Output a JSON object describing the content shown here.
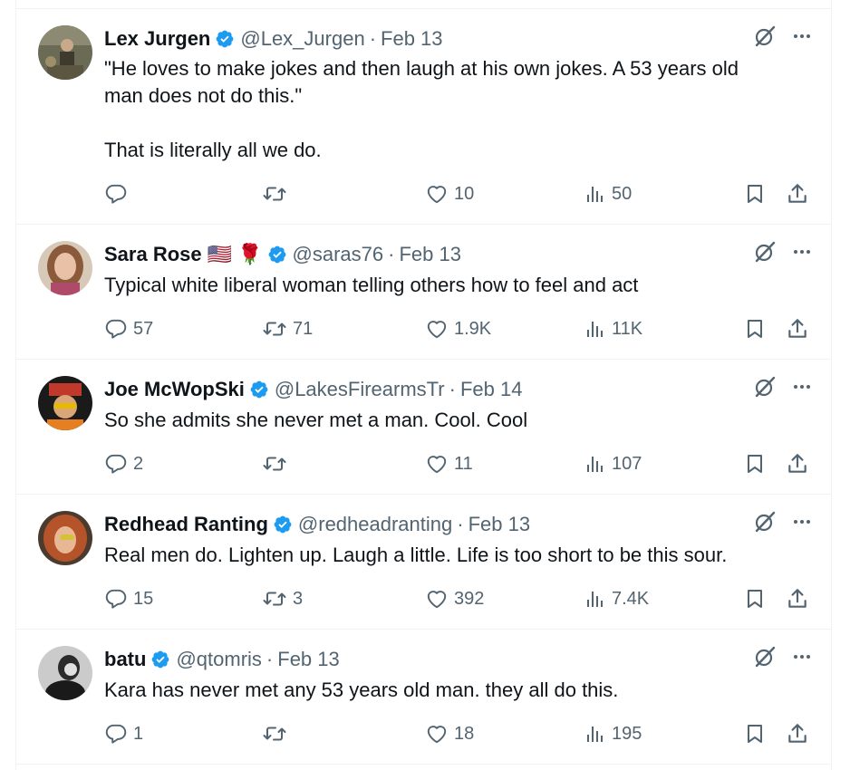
{
  "replies": [
    {
      "name": "Lex Jurgen",
      "emoji": "",
      "handle": "@Lex_Jurgen",
      "date": "Feb 13",
      "text": "\"He loves to make jokes and then laugh at his own jokes. A 53 years old\nman does not do this.\"\n\nThat is literally all we do.",
      "replies_count": "",
      "reposts_count": "",
      "likes_count": "10",
      "views_count": "50"
    },
    {
      "name": "Sara Rose",
      "emoji": "🇺🇸 🌹",
      "handle": "@saras76",
      "date": "Feb 13",
      "text": "Typical white liberal woman telling others how to feel and act",
      "replies_count": "57",
      "reposts_count": "71",
      "likes_count": "1.9K",
      "views_count": "11K"
    },
    {
      "name": "Joe McWopSki",
      "emoji": "",
      "handle": "@LakesFirearmsTr",
      "date": "Feb 14",
      "text": "So she admits she never met a man. Cool. Cool",
      "replies_count": "2",
      "reposts_count": "",
      "likes_count": "11",
      "views_count": "107"
    },
    {
      "name": "Redhead Ranting",
      "emoji": "",
      "handle": "@redheadranting",
      "date": "Feb 13",
      "text": "Real men do. Lighten up. Laugh a little. Life is too short to be this sour.",
      "replies_count": "15",
      "reposts_count": "3",
      "likes_count": "392",
      "views_count": "7.4K"
    },
    {
      "name": "batu",
      "emoji": "",
      "handle": "@qtomris",
      "date": "Feb 13",
      "text": "Kara has never met any 53 years old man. they all do this.",
      "replies_count": "1",
      "reposts_count": "",
      "likes_count": "18",
      "views_count": "195"
    }
  ],
  "icons": {
    "verified": "verified-badge-icon",
    "grok": "grok-icon",
    "more": "more-icon",
    "reply": "reply-icon",
    "repost": "repost-icon",
    "like": "like-icon",
    "views": "views-icon",
    "bookmark": "bookmark-icon",
    "share": "share-icon"
  },
  "colors": {
    "verified": "#1d9bf0",
    "secondary_text": "#536471",
    "primary_text": "#0f1419",
    "divider": "#eff3f4"
  }
}
